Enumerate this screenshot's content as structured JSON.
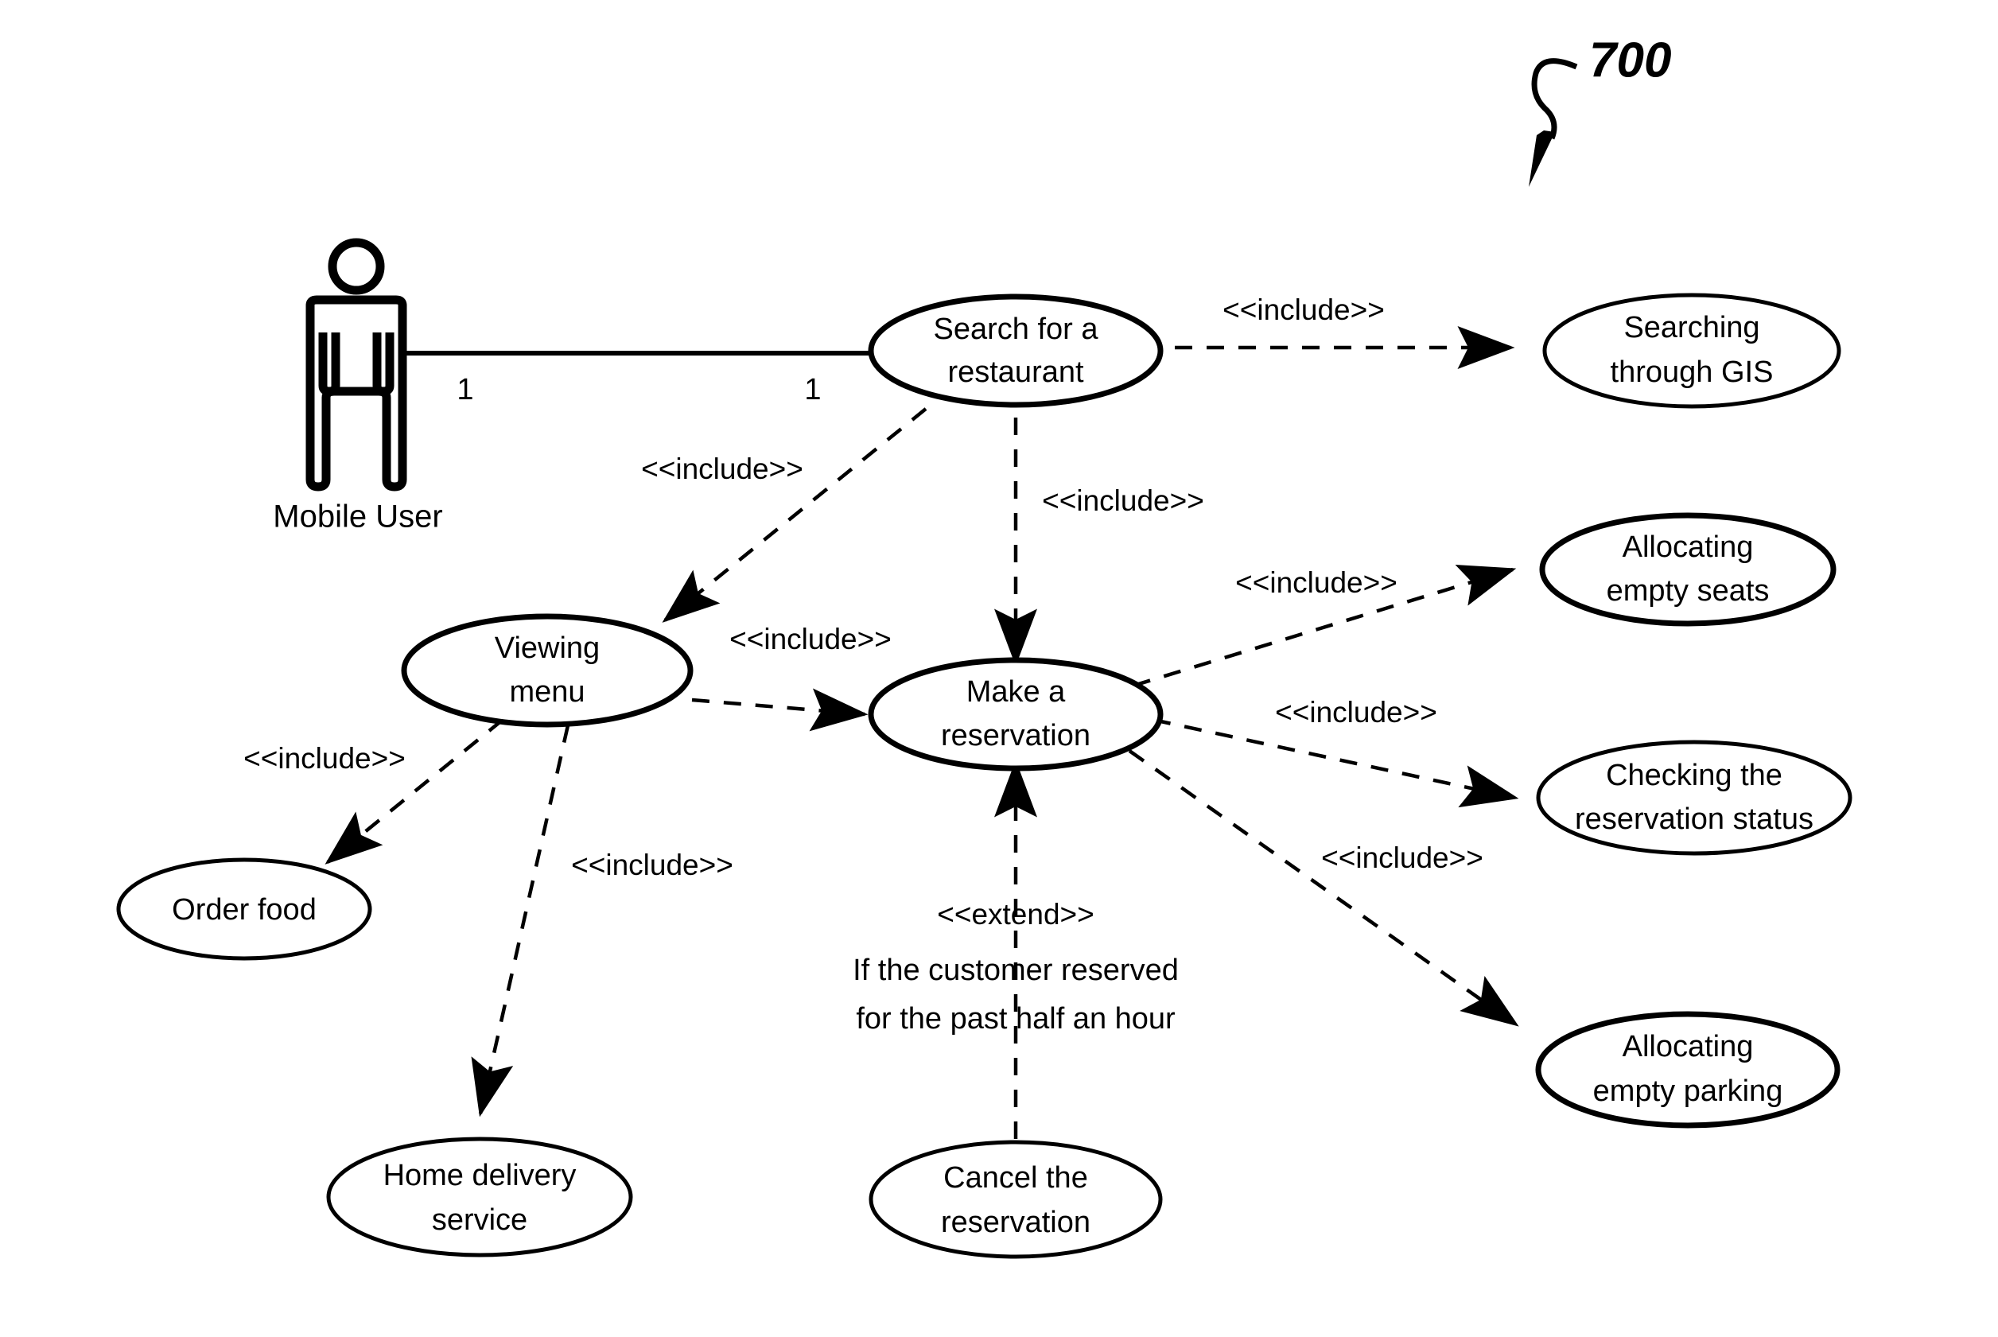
{
  "figure": {
    "number": "700"
  },
  "actor": {
    "name": "Mobile User",
    "icon": "actor-person-icon"
  },
  "association": {
    "source_multiplicity": "1",
    "target_multiplicity": "1"
  },
  "stereotypes": {
    "include": "<<include>>",
    "extend": "<<extend>>"
  },
  "extend_condition": {
    "line1": "If the customer reserved",
    "line2": "for the past half an hour"
  },
  "usecases": {
    "search_restaurant": {
      "line1": "Search for a",
      "line2": "restaurant"
    },
    "searching_gis": {
      "line1": "Searching",
      "line2": "through GIS"
    },
    "viewing_menu": {
      "line1": "Viewing",
      "line2": "menu"
    },
    "make_reservation": {
      "line1": "Make a",
      "line2": "reservation"
    },
    "allocating_seats": {
      "line1": "Allocating",
      "line2": "empty seats"
    },
    "checking_status": {
      "line1": "Checking the",
      "line2": "reservation status"
    },
    "allocating_parking": {
      "line1": "Allocating",
      "line2": "empty parking"
    },
    "order_food": {
      "line1": "Order food",
      "line2": ""
    },
    "home_delivery": {
      "line1": "Home delivery",
      "line2": "service"
    },
    "cancel_reservation": {
      "line1": "Cancel the",
      "line2": "reservation"
    }
  },
  "edge_labels": {
    "search_to_gis": "<<include>>",
    "search_to_viewing": "<<include>>",
    "search_to_make": "<<include>>",
    "viewing_to_make": "<<include>>",
    "viewing_to_order": "<<include>>",
    "viewing_to_home": "<<include>>",
    "make_to_seats": "<<include>>",
    "make_to_checking": "<<include>>",
    "make_to_parking": "<<include>>",
    "cancel_to_make": "<<extend>>"
  },
  "colors": {
    "stroke": "#000000",
    "background": "#ffffff"
  }
}
